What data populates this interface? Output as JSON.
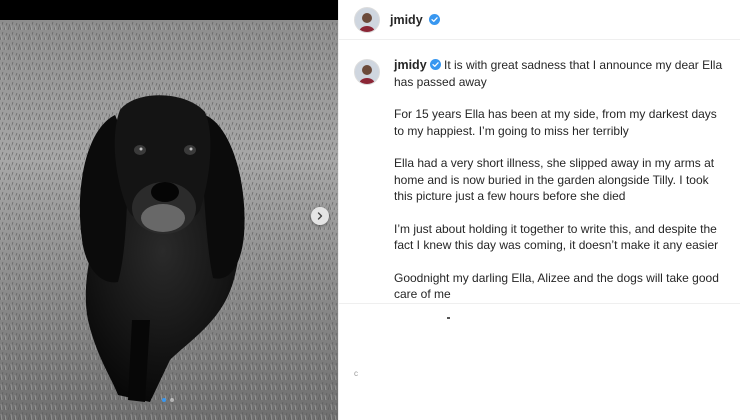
{
  "post": {
    "username": "jmidy",
    "verified": true,
    "caption_paragraphs": [
      "It is with great sadness that I announce my dear Ella has passed away",
      "For 15 years Ella has been at my side, from my darkest days to my happiest. I’m going to miss her terribly",
      "Ella had a very short illness, she slipped away in my arms at home and is now buried in the garden alongside Tilly. I took this picture just a few hours before she died",
      "I’m just about holding it together to write this, and despite the fact I knew this day was coming, it doesn’t make it any easier",
      "Goodnight my darling Ella, Alizee and the dogs will take good care of me"
    ]
  },
  "media": {
    "carousel_count": 2,
    "carousel_active_index": 0,
    "next_icon": "chevron-right-icon",
    "image": "black-and-white-photo-of-dog"
  },
  "icons": {
    "verified": "verified-badge-icon",
    "avatar": "profile-avatar"
  },
  "colors": {
    "verified_blue": "#3897f0",
    "text": "#262626",
    "border": "#efefef"
  }
}
